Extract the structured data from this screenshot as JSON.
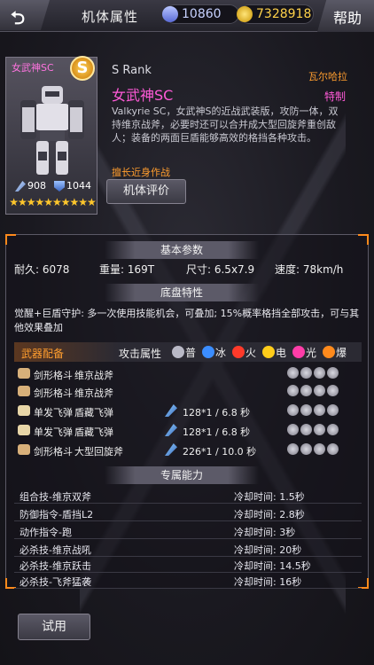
{
  "header": {
    "back_icon": "back-arrow-icon",
    "title": "机体属性",
    "gems": "10860",
    "coins": "7328918",
    "help_label": "帮助"
  },
  "unit_card": {
    "name": "女武神SC",
    "grade_badge": "S",
    "attack": "908",
    "defense": "1044",
    "stars": "★★★★★★★★★★"
  },
  "info": {
    "rank": "S Rank",
    "faction": "瓦尔哈拉",
    "name": "女武神SC",
    "special_tag": "特制",
    "description": "Valkyrie SC，女武神S的近战武装版，攻防一体，双持维京战斧，必要时还可以合并成大型回旋斧重创敌人；装备的两面巨盾能够高效的格挡各种攻击。",
    "specialty": "擅长近身作战",
    "evaluate_label": "机体评价"
  },
  "basic": {
    "header": "基本参数",
    "durability": "耐久: 6078",
    "weight": "重量: 169T",
    "size": "尺寸: 6.5x7.9",
    "speed": "速度: 78km/h"
  },
  "chassis": {
    "header": "底盘特性",
    "text": "觉醒+巨盾守护: 多一次使用技能机会，可叠加; 15%概率格挡全部攻击，可与其他效果叠加"
  },
  "weapons": {
    "title": "武器配备",
    "attr_label": "攻击属性",
    "elements": [
      {
        "label": "普",
        "color": "#b9b9c6"
      },
      {
        "label": "冰",
        "color": "#3b8dff"
      },
      {
        "label": "火",
        "color": "#ff3a2a"
      },
      {
        "label": "电",
        "color": "#ffcc1a"
      },
      {
        "label": "光",
        "color": "#ff3da8"
      },
      {
        "label": "爆",
        "color": "#ff8a1c"
      }
    ],
    "rows": [
      {
        "type": "剑形格斗",
        "name": "维京战斧",
        "dmg": ""
      },
      {
        "type": "剑形格斗",
        "name": "维京战斧",
        "dmg": ""
      },
      {
        "type": "单发飞弹",
        "name": "盾藏飞弹",
        "dmg": "128*1 / 6.8 秒"
      },
      {
        "type": "单发飞弹",
        "name": "盾藏飞弹",
        "dmg": "128*1 / 6.8 秒"
      },
      {
        "type": "剑形格斗",
        "name": "大型回旋斧",
        "dmg": "226*1 / 10.0 秒"
      }
    ]
  },
  "abilities": {
    "header": "专属能力",
    "rows": [
      {
        "name": "组合技-维京双斧",
        "cd": "冷却时间: 1.5秒"
      },
      {
        "name": "防御指令-盾挡L2",
        "cd": "冷却时间: 2.8秒"
      },
      {
        "name": "动作指令-跑",
        "cd": "冷却时间: 3秒"
      },
      {
        "name": "必杀技-维京战吼",
        "cd": "冷却时间: 20秒"
      },
      {
        "name": "必杀技-维京跃击",
        "cd": "冷却时间: 14.5秒"
      },
      {
        "name": "必杀技-飞斧猛袭",
        "cd": "冷却时间: 16秒"
      }
    ]
  },
  "footer": {
    "trial_label": "试用"
  }
}
